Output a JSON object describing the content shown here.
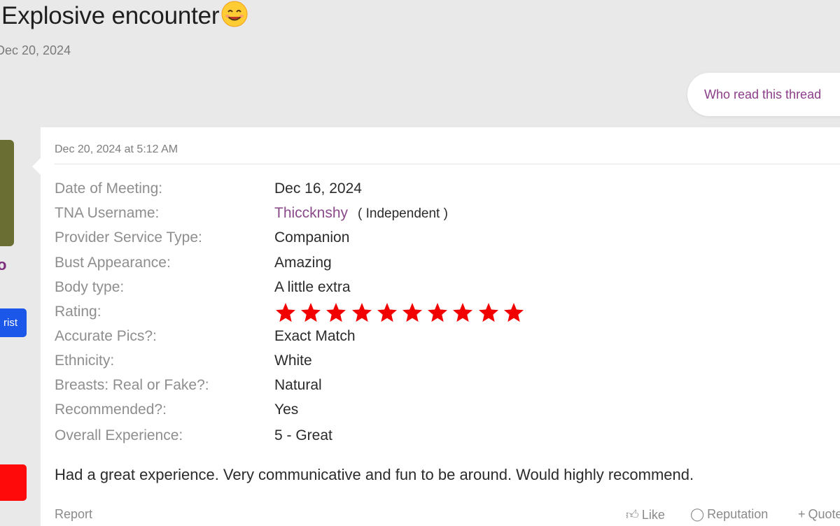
{
  "thread": {
    "title": "Explosive encounter",
    "emoji_icon": "smiling-face-emoji",
    "meta": "Dec 20, 2024"
  },
  "who_read_button": "Who read this thread",
  "user": {
    "name_fragment": "o",
    "badge_fragment": "rist"
  },
  "post": {
    "date": "Dec 20, 2024 at 5:12 AM",
    "fields": [
      {
        "label": "Date of Meeting:",
        "value": "Dec 16, 2024"
      },
      {
        "label": "TNA Username:",
        "value": "Thiccknshy",
        "extra": "( Independent )"
      },
      {
        "label": "Provider Service Type:",
        "value": "Companion"
      },
      {
        "label": "Bust Appearance:",
        "value": "Amazing"
      },
      {
        "label": "Body type:",
        "value": "A little extra"
      },
      {
        "label": "Rating:",
        "stars": 10
      },
      {
        "label": "Accurate Pics?:",
        "value": "Exact Match"
      },
      {
        "label": "Ethnicity:",
        "value": "White"
      },
      {
        "label": "Breasts: Real or Fake?:",
        "value": "Natural"
      },
      {
        "label": "Recommended?:",
        "value": "Yes"
      },
      {
        "label": "Overall Experience:",
        "value": "5 - Great"
      }
    ],
    "review": "Had a great experience. Very communicative and fun to be around. Would highly recommend.",
    "footer": {
      "report": "Report",
      "like": "Like",
      "reputation": "Reputation",
      "quote": "Quote"
    }
  },
  "colors": {
    "star": "#f20000",
    "link": "#8a4b8a",
    "badge_blue": "#1b57e8",
    "badge_red": "#ff0a0a"
  }
}
